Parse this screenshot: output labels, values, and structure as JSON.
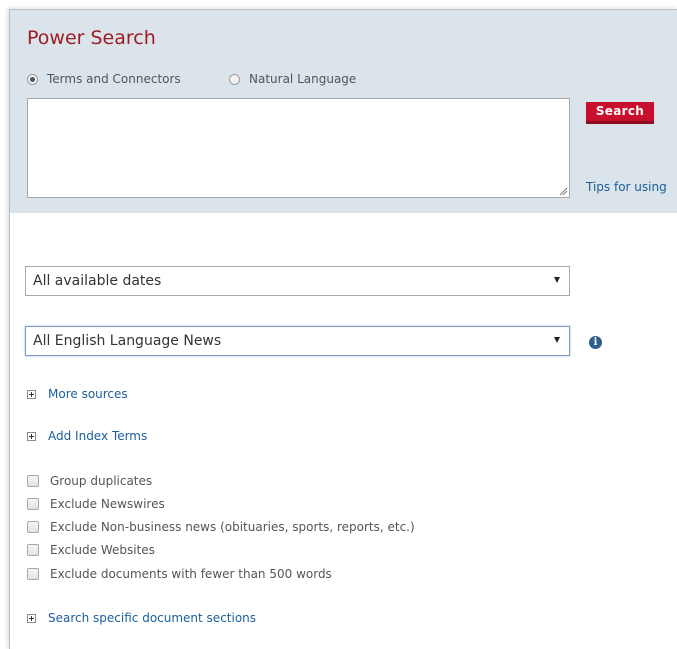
{
  "header": {
    "title": "Power Search"
  },
  "search_mode": {
    "options": [
      {
        "label": "Terms and Connectors",
        "selected": true
      },
      {
        "label": "Natural Language",
        "selected": false
      }
    ]
  },
  "search": {
    "query": "",
    "button_label": "Search",
    "tips_link": "Tips for using"
  },
  "filters": {
    "date_range": "All available dates",
    "source": "All English Language News"
  },
  "expanders": {
    "more_sources": "More sources",
    "add_index_terms": "Add Index Terms",
    "document_sections": "Search specific document sections"
  },
  "options": [
    {
      "label": "Group duplicates",
      "checked": false
    },
    {
      "label": "Exclude Newswires",
      "checked": false
    },
    {
      "label": "Exclude Non-business news (obituaries, sports, reports, etc.)",
      "checked": false
    },
    {
      "label": "Exclude Websites",
      "checked": false
    },
    {
      "label": "Exclude documents with fewer than 500 words",
      "checked": false
    }
  ],
  "colors": {
    "title": "#9e1c21",
    "panel_background": "#dce4eb",
    "search_button": "#c8102e",
    "link": "#1b5e9c",
    "info_icon": "#2f5d8c"
  },
  "icons": {
    "info": "info-circle-icon",
    "dropdown": "dropdown-arrow-icon",
    "expand": "plus-box-icon"
  }
}
